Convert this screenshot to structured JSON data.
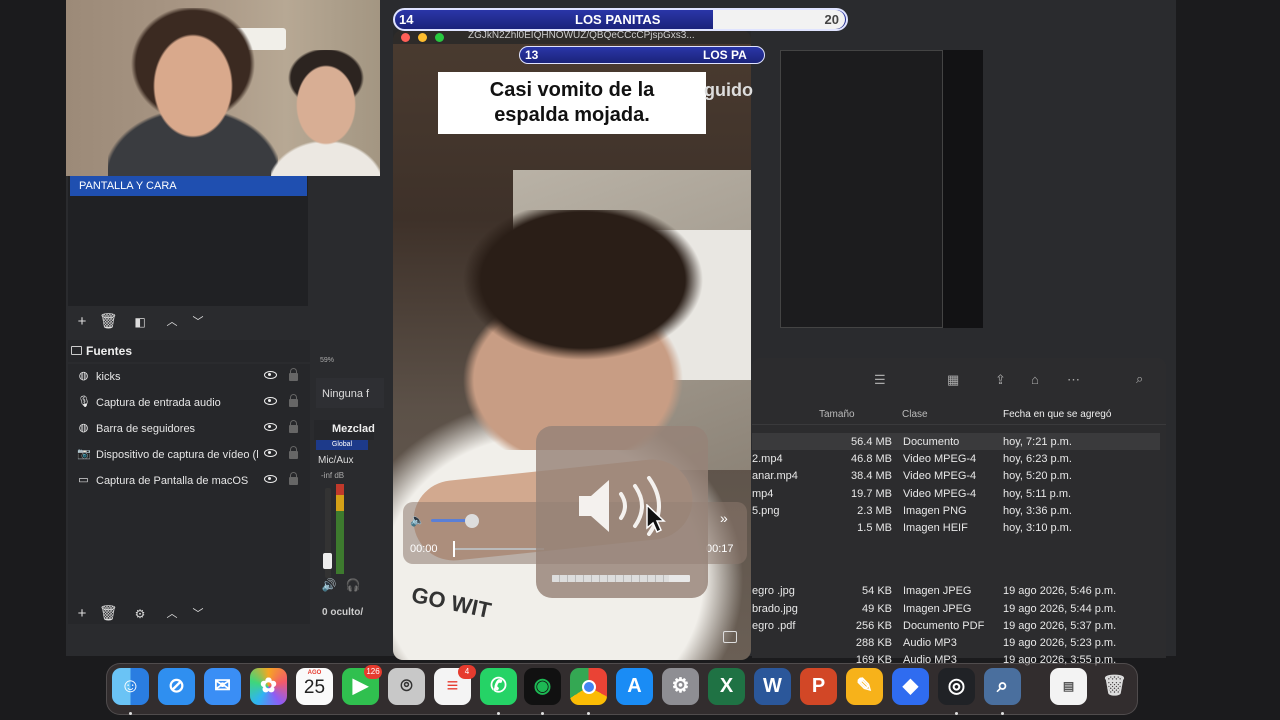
{
  "obs": {
    "scenes": {
      "selected": "PANTALLA Y CARA"
    },
    "sources": {
      "title": "Fuentes",
      "items": [
        {
          "label": "kicks",
          "icon": "browser-icon"
        },
        {
          "label": "Captura de entrada audio",
          "icon": "mic-icon"
        },
        {
          "label": "Barra de seguidores",
          "icon": "browser-icon"
        },
        {
          "label": "Dispositivo de captura de vídeo (h",
          "icon": "camera-icon"
        },
        {
          "label": "Captura de Pantalla de macOS",
          "icon": "display-icon"
        }
      ]
    },
    "mixer": {
      "title": "Mezclad",
      "global": "Global",
      "channel": "Mic/Aux",
      "db": "-inf dB",
      "hidden": "0 oculto/"
    },
    "preview_zoom": "59%",
    "transition": "Ninguna f"
  },
  "scorebar": {
    "left_count": "14",
    "name": "LOS PANITAS",
    "right_count": "20"
  },
  "scorebar2": {
    "left_count": "13",
    "name": "LOS PA"
  },
  "video": {
    "url": "ZGJkN2Zhl0EIQHNOWUZ/QBQeCCcCPjspGxs3...",
    "caption_line1": "Casi vomito de la",
    "caption_line2": "espalda mojada.",
    "caption_overflow": "guido",
    "time_start": "00:00",
    "time_end": "00:17",
    "volume_level": 0.85,
    "shirt_text": "GO WIT"
  },
  "finder": {
    "columns": {
      "size": "Tamaño",
      "kind": "Clase",
      "date": "Fecha en que se agregó"
    },
    "rows": [
      {
        "name": "",
        "size": "56.4 MB",
        "kind": "Documento",
        "date": "hoy, 7:21 p.m."
      },
      {
        "name": "2.mp4",
        "size": "46.8 MB",
        "kind": "Video MPEG-4",
        "date": "hoy, 6:23 p.m."
      },
      {
        "name": "anar.mp4",
        "size": "38.4 MB",
        "kind": "Video MPEG-4",
        "date": "hoy, 5:20 p.m."
      },
      {
        "name": "mp4",
        "size": "19.7 MB",
        "kind": "Video MPEG-4",
        "date": "hoy, 5:11 p.m."
      },
      {
        "name": "5.png",
        "size": "2.3 MB",
        "kind": "Imagen PNG",
        "date": "hoy, 3:36 p.m."
      },
      {
        "name": "",
        "size": "1.5 MB",
        "kind": "Imagen HEIF",
        "date": "hoy, 3:10 p.m."
      },
      {
        "name": "egro .jpg",
        "size": "54 KB",
        "kind": "Imagen JPEG",
        "date": "19 ago 2026, 5:46 p.m."
      },
      {
        "name": "brado.jpg",
        "size": "49 KB",
        "kind": "Imagen JPEG",
        "date": "19 ago 2026, 5:44 p.m."
      },
      {
        "name": "egro .pdf",
        "size": "256 KB",
        "kind": "Documento PDF",
        "date": "19 ago 2026, 5:37 p.m."
      },
      {
        "name": "",
        "size": "288 KB",
        "kind": "Audio MP3",
        "date": "19 ago 2026, 5:23 p.m."
      },
      {
        "name": "",
        "size": "169 KB",
        "kind": "Audio MP3",
        "date": "19 ago 2026, 3:55 p.m."
      }
    ]
  },
  "dock": {
    "calendar_month": "AGO",
    "calendar_day": "25",
    "facetime_badge": "126",
    "reminders_badge": "4",
    "apps": [
      "Finder",
      "Safari",
      "Mail",
      "Fotos",
      "Calendario",
      "FaceTime",
      "Captura",
      "Recordatorios",
      "WhatsApp",
      "Spotify",
      "Chrome",
      "App Store",
      "Configuración",
      "Excel",
      "Word",
      "PowerPoint",
      "Notas",
      "Roblox",
      "OBS",
      "Vista previa",
      "Documento",
      "Papelera"
    ]
  }
}
